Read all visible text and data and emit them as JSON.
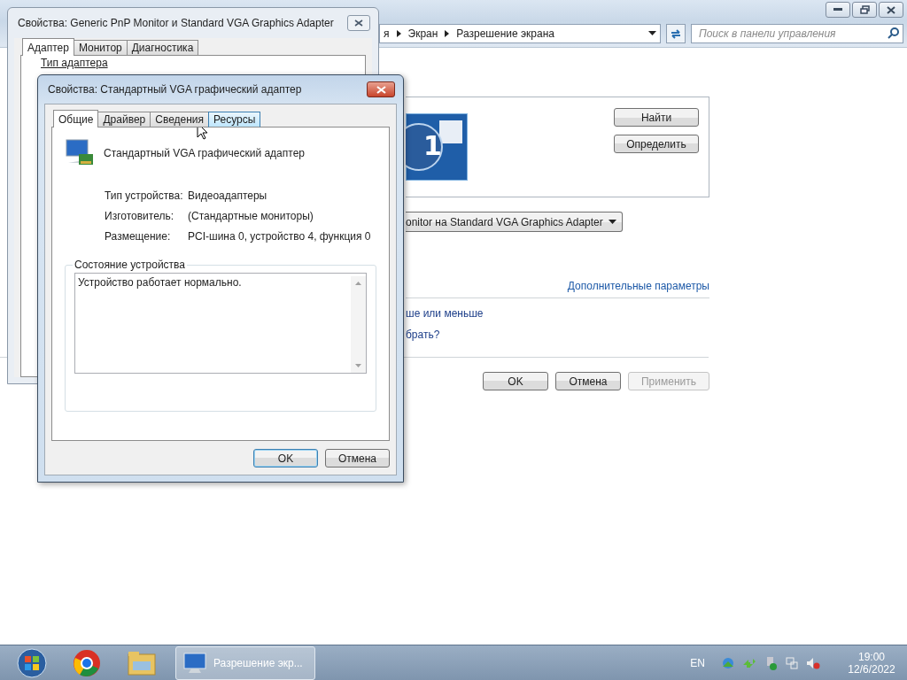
{
  "control_panel": {
    "breadcrumb": [
      "я",
      "Экран",
      "Разрешение экрана"
    ],
    "search": {
      "placeholder": "Поиск в панели управления"
    },
    "monitor_label": "1",
    "side_buttons": [
      {
        "label": "Найти"
      },
      {
        "label": "Определить"
      }
    ],
    "display_select": {
      "value": "onitor на Standard VGA Graphics Adapter"
    },
    "advanced_link": "Дополнительные параметры",
    "links": [
      "ше или меньше",
      "брать?"
    ],
    "buttons": [
      {
        "label": "OK",
        "disabled": false
      },
      {
        "label": "Отмена",
        "disabled": false
      },
      {
        "label": "Применить",
        "disabled": true
      }
    ]
  },
  "back_dialog": {
    "title": "Свойства: Generic PnP Monitor и Standard VGA Graphics Adapter",
    "tabs": [
      {
        "label": "Адаптер",
        "selected": true
      },
      {
        "label": "Монитор",
        "selected": false
      },
      {
        "label": "Диагностика",
        "selected": false
      }
    ],
    "group_label": "Тип адаптера"
  },
  "front_dialog": {
    "title": "Свойства: Стандартный VGA графический адаптер",
    "tabs": [
      {
        "label": "Общие",
        "selected": true,
        "hovered": false
      },
      {
        "label": "Драйвер",
        "selected": false,
        "hovered": false
      },
      {
        "label": "Сведения",
        "selected": false,
        "hovered": false
      },
      {
        "label": "Ресурсы",
        "selected": false,
        "hovered": true
      }
    ],
    "device_name": "Стандартный VGA графический адаптер",
    "properties": [
      {
        "label": "Тип устройства:",
        "value": "Видеоадаптеры"
      },
      {
        "label": "Изготовитель:",
        "value": "(Стандартные мониторы)"
      },
      {
        "label": "Размещение:",
        "value": "PCI-шина 0, устройство 4, функция 0"
      }
    ],
    "status_group": "Состояние устройства",
    "status_text": "Устройство работает нормально.",
    "buttons": [
      {
        "label": "OK",
        "default": true
      },
      {
        "label": "Отмена",
        "default": false
      }
    ]
  },
  "taskbar": {
    "tasks": [
      {
        "label": "Разрешение экр...",
        "active": true
      }
    ],
    "language": "EN",
    "time": "19:00",
    "date": "12/6/2022"
  }
}
